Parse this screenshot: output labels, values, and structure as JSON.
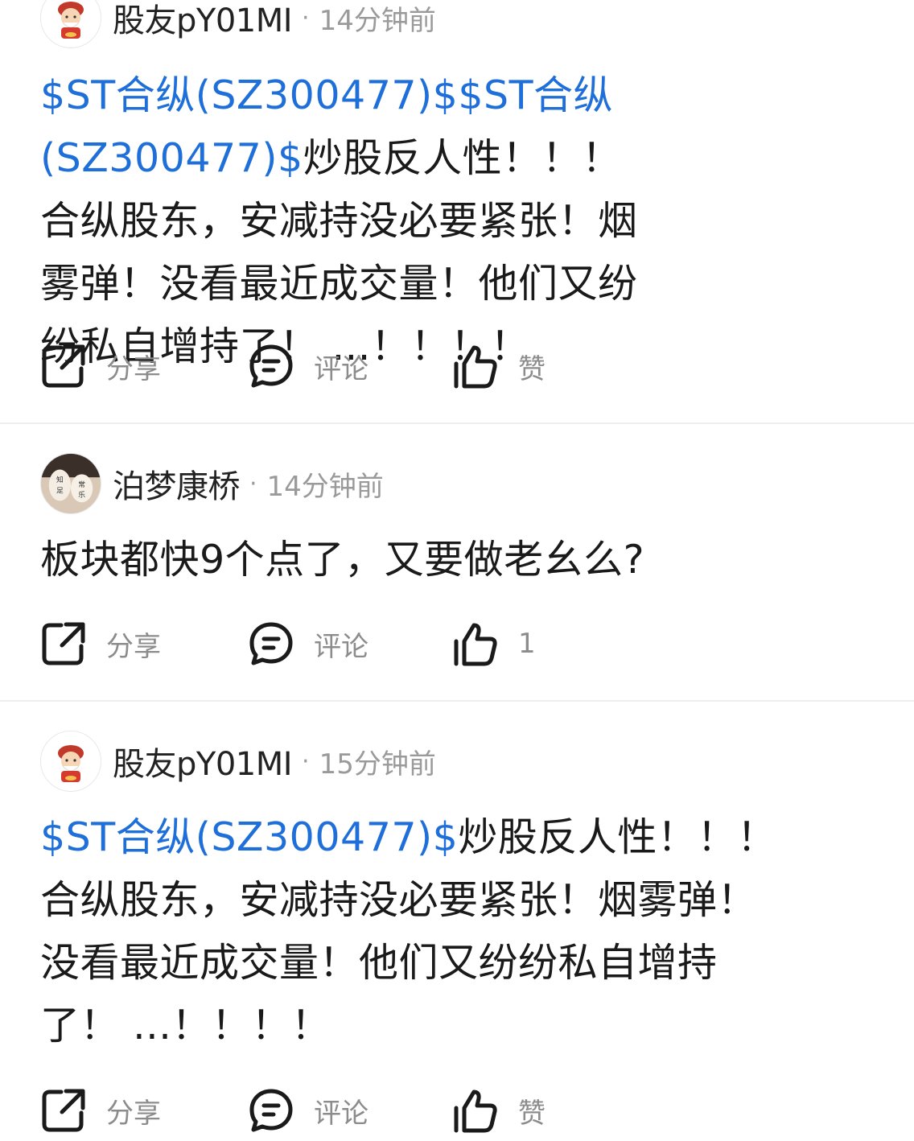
{
  "posts": [
    {
      "author": "股友pY01MI",
      "time": "14分钟前",
      "stock_link_1": "$ST合纵(SZ300477)$",
      "stock_link_2": "$ST合纵(SZ300477)$",
      "text": "炒股反人性！！！ 合纵股东，安减持没必要紧张！烟雾弹！没看最近成交量！他们又纷纷私自增持了！ ...！！！！",
      "share": "分享",
      "comment": "评论",
      "like": "赞"
    },
    {
      "author": "泊梦康桥",
      "time": "14分钟前",
      "text": "板块都快9个点了，又要做老幺么?",
      "share": "分享",
      "comment": "评论",
      "like": "1"
    },
    {
      "author": "股友pY01MI",
      "time": "15分钟前",
      "stock_link_1": "$ST合纵(SZ300477)$",
      "text": "炒股反人性！！！合纵股东，安减持没必要紧张！烟雾弹！没看最近成交量！他们又纷纷私自增持了！ ...！！！！",
      "share": "分享",
      "comment": "评论",
      "like": "赞"
    }
  ],
  "separator": "·",
  "colors": {
    "link": "#1e6fd9",
    "muted": "#9a9a9a",
    "icon": "#1a1a1a"
  },
  "icons": [
    "share-icon",
    "comment-icon",
    "thumbs-up-icon"
  ]
}
